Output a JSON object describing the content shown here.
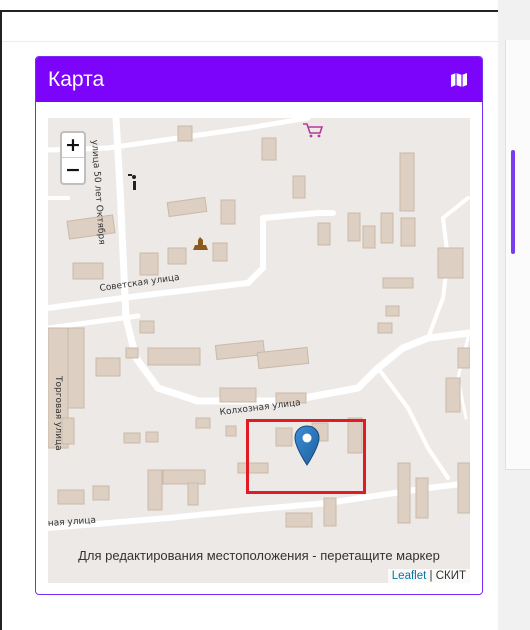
{
  "card": {
    "title": "Карта",
    "title_icon": "map-icon",
    "accent_color": "#7d04fb"
  },
  "map": {
    "zoom_in_label": "+",
    "zoom_out_label": "−",
    "hint": "Для редактирования местоположения - перетащите маркер",
    "attribution_link": "Leaflet",
    "attribution_separator": " | ",
    "attribution_source": "СКИТ",
    "streets": [
      "улица 50 лет Октября",
      "Советская улица",
      "Колхозная улица",
      "Торговая улица",
      "ная улица"
    ],
    "marker_icon": "map-pin-icon",
    "highlight_color": "#e01b24"
  }
}
